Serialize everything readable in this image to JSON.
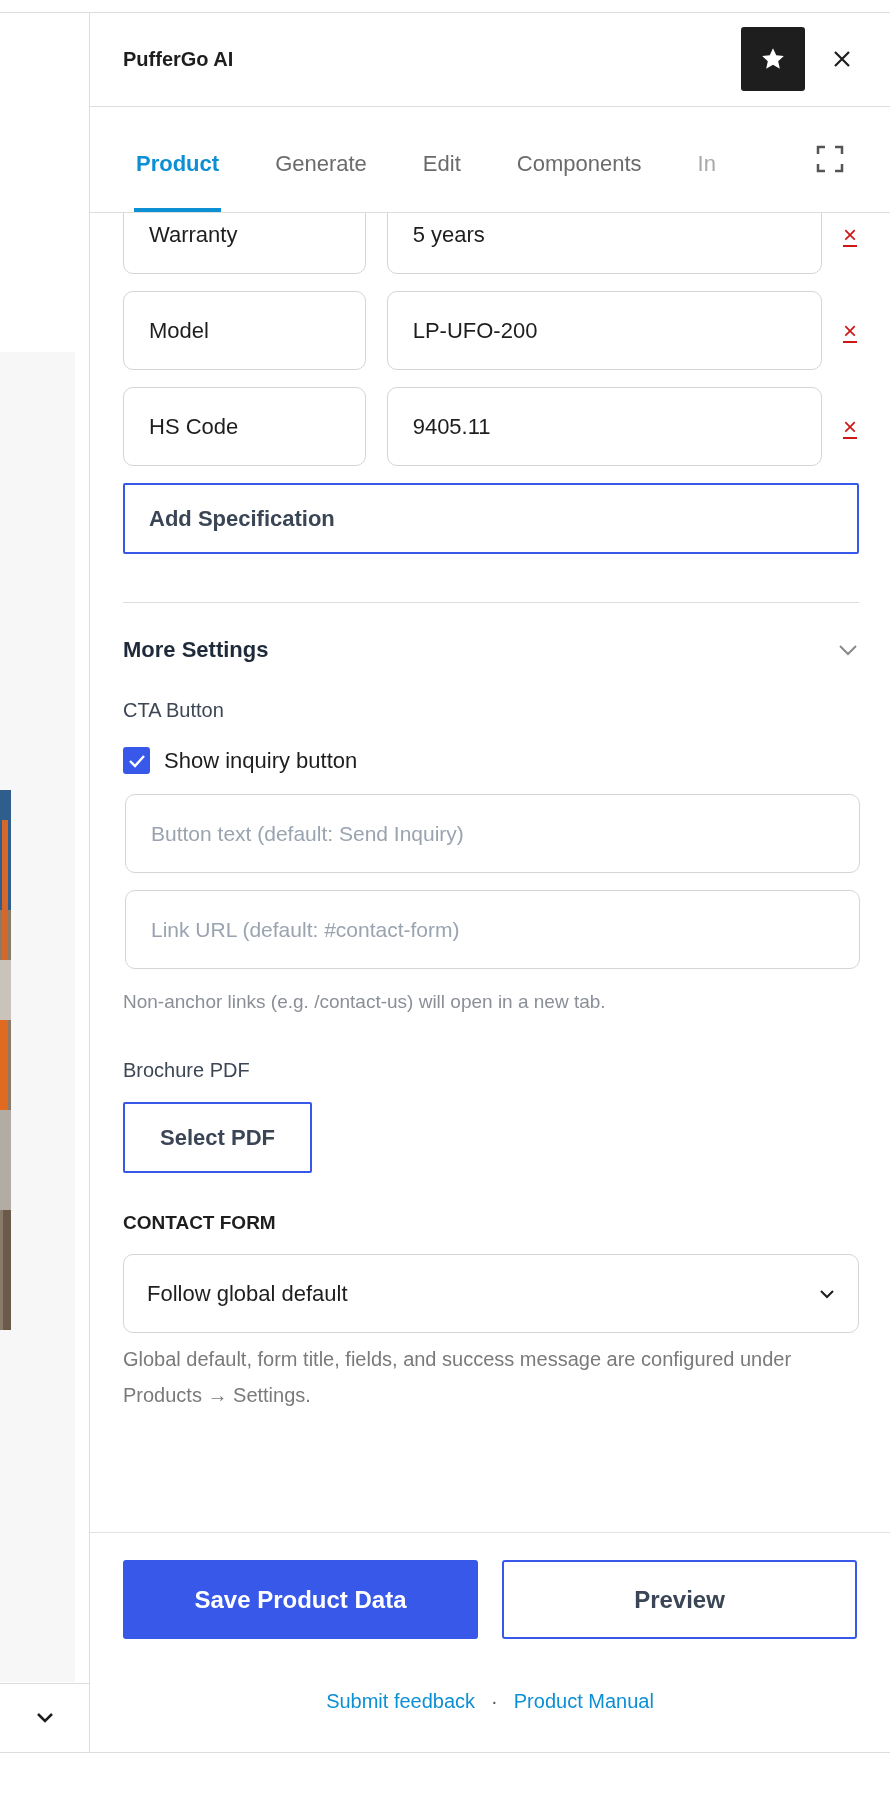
{
  "panel": {
    "title": "PufferGo AI"
  },
  "tabs": [
    {
      "label": "Product",
      "selected": true
    },
    {
      "label": "Generate",
      "selected": false
    },
    {
      "label": "Edit",
      "selected": false
    },
    {
      "label": "Components",
      "selected": false
    },
    {
      "label": "In",
      "selected": false
    }
  ],
  "specifications": [
    {
      "key": "Warranty",
      "value": "5 years",
      "remove": "×"
    },
    {
      "key": "Model",
      "value": "LP-UFO-200",
      "remove": "×"
    },
    {
      "key": "HS Code",
      "value": "9405.11",
      "remove": "×"
    }
  ],
  "add_specification": "Add Specification",
  "more_settings": {
    "title": "More Settings",
    "expanded": true,
    "cta_label": "CTA Button",
    "show_inquiry": {
      "label": "Show inquiry button",
      "checked": true
    },
    "button_text": {
      "placeholder": "Button text (default: Send Inquiry)"
    },
    "link_url": {
      "placeholder": "Link URL (default: #contact-form)"
    },
    "link_hint": "Non-anchor links (e.g. /contact-us) will open in a new tab.",
    "brochure_label": "Brochure PDF",
    "select_pdf": "Select PDF",
    "contact_form_label": "CONTACT FORM",
    "contact_form_value": "Follow global default",
    "contact_form_hint": "Global default, form title, fields, and success message are configured under Products → Settings."
  },
  "actions": [
    "Save Product Data",
    "Preview"
  ],
  "links": [
    "Submit feedback",
    "Product Manual"
  ],
  "link_separator": "·"
}
